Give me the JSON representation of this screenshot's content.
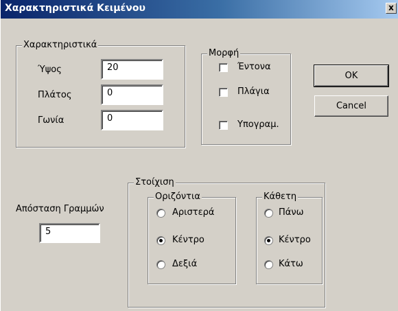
{
  "window": {
    "title": "Χαρακτηριστικά Κειμένου",
    "close_glyph": "x"
  },
  "characteristics": {
    "legend": "Χαρακτηριστικά",
    "height_label": "Ύψος",
    "height_value": "20",
    "width_label": "Πλάτος",
    "width_value": "0",
    "angle_label": "Γωνία",
    "angle_value": "0"
  },
  "format": {
    "legend": "Μορφή",
    "bold_label": "Έντονα",
    "italic_label": "Πλάγια",
    "underline_label": "Υπογραμ."
  },
  "buttons": {
    "ok": "OK",
    "cancel": "Cancel"
  },
  "line_spacing": {
    "label": "Απόσταση Γραμμών",
    "value": "5"
  },
  "alignment": {
    "legend": "Στοίχιση",
    "horizontal": {
      "legend": "Οριζόντια",
      "options": [
        "Αριστερά",
        "Κέντρο",
        "Δεξιά"
      ],
      "selected": "Κέντρο"
    },
    "vertical": {
      "legend": "Κάθετη",
      "options": [
        "Πάνω",
        "Κέντρο",
        "Κάτω"
      ],
      "selected": "Κέντρο"
    }
  }
}
